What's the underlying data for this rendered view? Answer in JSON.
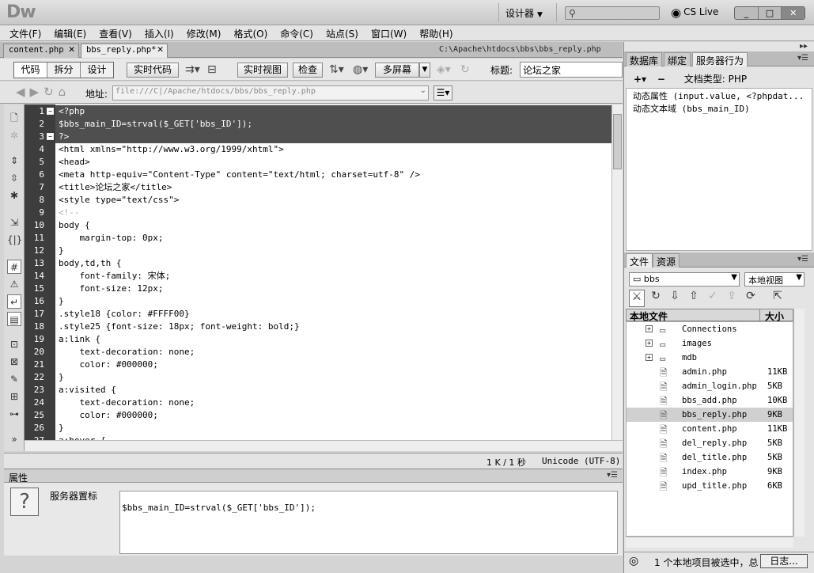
{
  "app": {
    "logo": "Dw",
    "workspace": "设计器",
    "live": "CS Live",
    "window_buttons": [
      "_",
      "□",
      "✕"
    ]
  },
  "menu": [
    "文件(F)",
    "编辑(E)",
    "查看(V)",
    "插入(I)",
    "修改(M)",
    "格式(O)",
    "命令(C)",
    "站点(S)",
    "窗口(W)",
    "帮助(H)"
  ],
  "tabs": [
    {
      "label": "content.php"
    },
    {
      "label": "bbs_reply.php*"
    }
  ],
  "doc_path": "C:\\Apache\\htdocs\\bbs\\bbs_reply.php",
  "toolbar": {
    "views": [
      "代码",
      "拆分",
      "设计"
    ],
    "live_code": "实时代码",
    "live_view": "实时视图",
    "inspect": "检查",
    "multiscreen": "多屏幕",
    "title_label": "标题:",
    "title_value": "论坛之家"
  },
  "address": {
    "label": "地址:",
    "value": "file:///C|/Apache/htdocs/bbs/bbs_reply.php"
  },
  "code_lines": [
    {
      "n": "1",
      "t": "<?php",
      "sel": true
    },
    {
      "n": "2",
      "t": "$bbs_main_ID=strval($_GET['bbs_ID']);",
      "sel": true
    },
    {
      "n": "3",
      "t": "?>",
      "sel": true
    },
    {
      "n": "4",
      "t": "<html xmlns=\"http://www.w3.org/1999/xhtml\">"
    },
    {
      "n": "5",
      "t": "<head>"
    },
    {
      "n": "6",
      "t": "<meta http-equiv=\"Content-Type\" content=\"text/html; charset=utf-8\" />"
    },
    {
      "n": "7",
      "t": "<title>论坛之家</title>"
    },
    {
      "n": "8",
      "t": "<style type=\"text/css\">"
    },
    {
      "n": "9",
      "t": "<!--",
      "cm": true
    },
    {
      "n": "10",
      "t": "body {"
    },
    {
      "n": "11",
      "t": "    margin-top: 0px;"
    },
    {
      "n": "12",
      "t": "}"
    },
    {
      "n": "13",
      "t": "body,td,th {"
    },
    {
      "n": "14",
      "t": "    font-family: 宋体;"
    },
    {
      "n": "15",
      "t": "    font-size: 12px;"
    },
    {
      "n": "16",
      "t": "}"
    },
    {
      "n": "17",
      "t": ".style18 {color: #FFFF00}"
    },
    {
      "n": "18",
      "t": ".style25 {font-size: 18px; font-weight: bold;}"
    },
    {
      "n": "19",
      "t": "a:link {"
    },
    {
      "n": "20",
      "t": "    text-decoration: none;"
    },
    {
      "n": "21",
      "t": "    color: #000000;"
    },
    {
      "n": "22",
      "t": "}"
    },
    {
      "n": "23",
      "t": "a:visited {"
    },
    {
      "n": "24",
      "t": "    text-decoration: none;"
    },
    {
      "n": "25",
      "t": "    color: #000000;"
    },
    {
      "n": "26",
      "t": "}"
    },
    {
      "n": "27",
      "t": "a:hover {"
    }
  ],
  "status": {
    "size": "1 K / 1 秒",
    "encoding": "Unicode (UTF-8)"
  },
  "properties": {
    "title": "属性",
    "label": "服务器置标",
    "value": "$bbs_main_ID=strval($_GET['bbs_ID']);"
  },
  "right_top": {
    "tabs": [
      "数据库",
      "绑定",
      "服务器行为"
    ],
    "doc_type": "文档类型: PHP",
    "items": [
      "动态属性 (input.value, <?phpdat...",
      "动态文本域 (bbs_main_ID)"
    ]
  },
  "files": {
    "tabs": [
      "文件",
      "资源"
    ],
    "site": "bbs",
    "view": "本地视图",
    "col_name": "本地文件",
    "col_size": "大小",
    "items": [
      {
        "name": "Connections",
        "size": "",
        "folder": true
      },
      {
        "name": "images",
        "size": "",
        "folder": true
      },
      {
        "name": "mdb",
        "size": "",
        "folder": true
      },
      {
        "name": "admin.php",
        "size": "11KB"
      },
      {
        "name": "admin_login.php",
        "size": "5KB"
      },
      {
        "name": "bbs_add.php",
        "size": "10KB"
      },
      {
        "name": "bbs_reply.php",
        "size": "9KB",
        "sel": true
      },
      {
        "name": "content.php",
        "size": "11KB"
      },
      {
        "name": "del_reply.php",
        "size": "5KB"
      },
      {
        "name": "del_title.php",
        "size": "5KB"
      },
      {
        "name": "index.php",
        "size": "9KB"
      },
      {
        "name": "upd_title.php",
        "size": "6KB"
      }
    ],
    "status": "1 个本地项目被选中，总",
    "log_button": "日志..."
  }
}
